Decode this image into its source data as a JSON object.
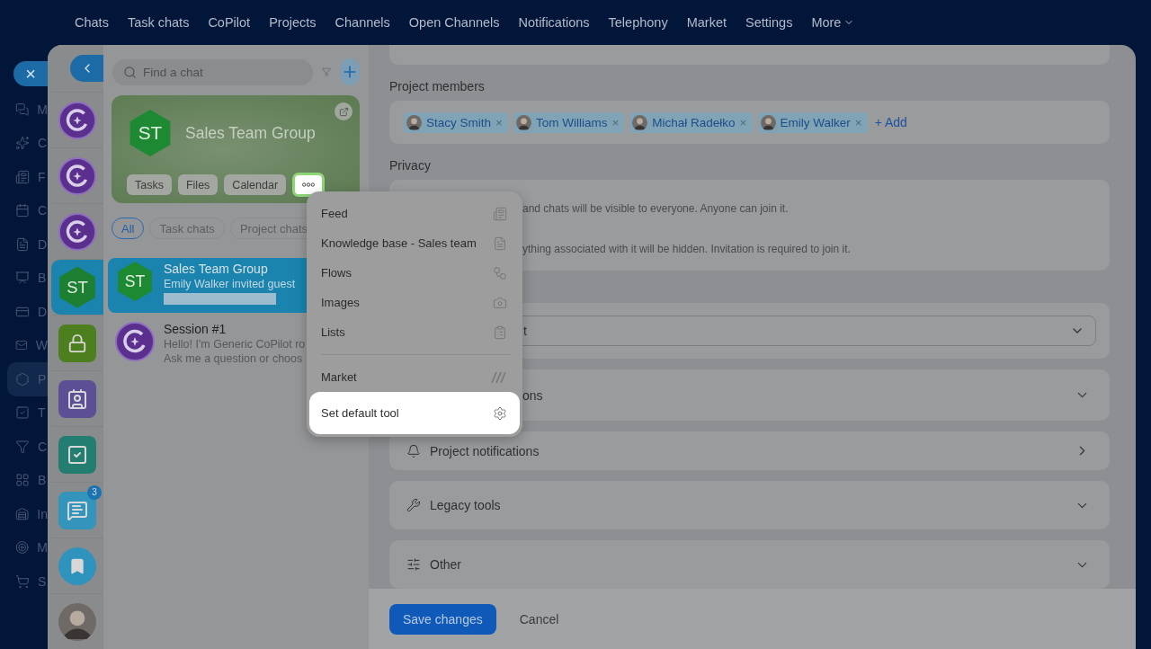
{
  "top_nav": {
    "items": [
      {
        "label": "Chats"
      },
      {
        "label": "Task chats"
      },
      {
        "label": "CoPilot"
      },
      {
        "label": "Projects"
      },
      {
        "label": "Channels"
      },
      {
        "label": "Open Channels"
      },
      {
        "label": "Notifications"
      },
      {
        "label": "Telephony"
      },
      {
        "label": "Market"
      },
      {
        "label": "Settings"
      },
      {
        "label": "More",
        "kind": "dropdown"
      }
    ]
  },
  "sidebar": {
    "close": "×",
    "items": [
      {
        "label": "M",
        "selected": false
      },
      {
        "label": "C",
        "selected": false
      },
      {
        "label": "F",
        "selected": false
      },
      {
        "label": "C",
        "selected": false
      },
      {
        "label": "D",
        "selected": false
      },
      {
        "label": "B",
        "selected": false
      },
      {
        "label": "D",
        "selected": false
      },
      {
        "label": "W",
        "selected": false
      },
      {
        "label": "P",
        "selected": true
      },
      {
        "label": "T",
        "selected": false
      },
      {
        "label": "C",
        "selected": false
      },
      {
        "label": "B",
        "selected": false
      },
      {
        "label": "In",
        "selected": false
      },
      {
        "label": "M",
        "selected": false
      },
      {
        "label": "S",
        "selected": false
      }
    ]
  },
  "rail": {
    "items": [
      {
        "kind": "copilot",
        "selected": false
      },
      {
        "kind": "copilot",
        "selected": false
      },
      {
        "kind": "copilot",
        "selected": false
      },
      {
        "kind": "group",
        "initials": "ST",
        "selected": true
      },
      {
        "kind": "lock",
        "selected": false
      },
      {
        "kind": "contact",
        "selected": false
      },
      {
        "kind": "task",
        "selected": false
      },
      {
        "kind": "messages",
        "badge": "3",
        "selected": false
      },
      {
        "kind": "bookmark",
        "selected": false
      },
      {
        "kind": "person",
        "selected": false
      }
    ]
  },
  "chat_panel": {
    "search": {
      "placeholder": "Find a chat"
    },
    "group_card": {
      "initials": "ST",
      "title": "Sales Team Group",
      "buttons": [
        "Tasks",
        "Files",
        "Calendar"
      ],
      "more_highlighted": true
    },
    "filters": [
      {
        "label": "All",
        "selected": true
      },
      {
        "label": "Task chats",
        "selected": false
      },
      {
        "label": "Project chats",
        "selected": false
      }
    ],
    "chats": [
      {
        "kind": "group",
        "initials": "ST",
        "title": "Sales Team Group",
        "preview": [
          "Emily Walker invited guest"
        ],
        "redacted": true,
        "selected": true
      },
      {
        "kind": "copilot",
        "title": "Session #1",
        "preview": [
          "Hello! I'm Generic CoPilot ro",
          "Ask me a question or choos"
        ],
        "redacted": false,
        "selected": false
      }
    ]
  },
  "menu": {
    "groups": [
      [
        {
          "label": "Feed",
          "highlighted": false
        },
        {
          "label": "Knowledge base - Sales team",
          "highlighted": false
        },
        {
          "label": "Flows",
          "highlighted": false
        },
        {
          "label": "Images",
          "highlighted": false
        },
        {
          "label": "Lists",
          "highlighted": false
        }
      ],
      [
        {
          "label": "Market",
          "highlighted": false
        },
        {
          "label": "Set default tool",
          "highlighted": true
        }
      ]
    ]
  },
  "form": {
    "members": {
      "label": "Project members",
      "people": [
        {
          "name": "Stacy Smith",
          "remove": "×"
        },
        {
          "name": "Tom Williams",
          "remove": "×"
        },
        {
          "name": "Michał Radełko",
          "remove": "×"
        },
        {
          "name": "Emily Walker",
          "remove": "×"
        }
      ],
      "add": "+ Add"
    },
    "privacy": {
      "label": "Privacy",
      "lines": [
        "and chats will be visible to everyone. Anyone can join it.",
        "ything associated with it will be hidden. Invitation is required to join it."
      ]
    },
    "select": {
      "value": "t"
    },
    "sections": [
      {
        "label": "ons",
        "kind": "accordion"
      },
      {
        "label": "Project notifications",
        "kind": "link"
      },
      {
        "label": "Legacy tools",
        "kind": "accordion"
      },
      {
        "label": "Other",
        "kind": "accordion"
      }
    ]
  },
  "footer": {
    "save": "Save changes",
    "cancel": "Cancel"
  }
}
